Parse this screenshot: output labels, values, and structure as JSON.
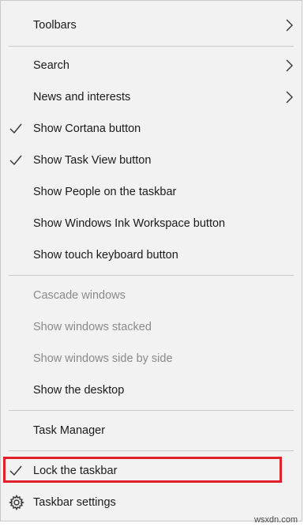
{
  "menu": {
    "toolbars": "Toolbars",
    "search": "Search",
    "news": "News and interests",
    "cortana": "Show Cortana button",
    "task_view": "Show Task View button",
    "people": "Show People on the taskbar",
    "ink": "Show Windows Ink Workspace button",
    "touch_keyboard": "Show touch keyboard button",
    "cascade": "Cascade windows",
    "stacked": "Show windows stacked",
    "side_by_side": "Show windows side by side",
    "desktop": "Show the desktop",
    "task_manager": "Task Manager",
    "lock": "Lock the taskbar",
    "settings": "Taskbar settings"
  },
  "checked": {
    "cortana": true,
    "task_view": true,
    "lock": true
  },
  "disabled": [
    "cascade",
    "stacked",
    "side_by_side"
  ],
  "highlight_color": "#e0202a",
  "watermark": "wsxdn.com"
}
